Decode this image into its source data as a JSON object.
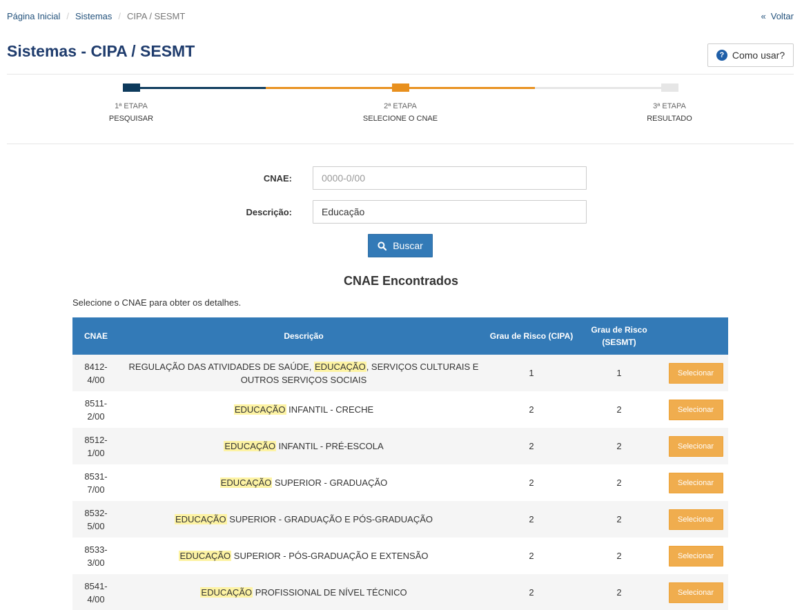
{
  "breadcrumb": {
    "home": "Página Inicial",
    "systems": "Sistemas",
    "current": "CIPA / SESMT",
    "separator": "/"
  },
  "back": {
    "chevron": "«",
    "label": "Voltar"
  },
  "page": {
    "title": "Sistemas - CIPA / SESMT"
  },
  "help": {
    "icon": "question-circle-icon",
    "glyph": "?",
    "label": "Como usar?"
  },
  "steps": [
    {
      "num": "1ª ETAPA",
      "label": "PESQUISAR",
      "status": "completed"
    },
    {
      "num": "2ª ETAPA",
      "label": "SELECIONE O CNAE",
      "status": "active"
    },
    {
      "num": "3ª ETAPA",
      "label": "RESULTADO",
      "status": "pending"
    }
  ],
  "colors": {
    "completed": "#0d3a5c",
    "active": "#e8901e",
    "pending": "#e6e6e6",
    "primary": "#337ab7",
    "warning": "#f0ad4e",
    "highlight": "#fdf3a3"
  },
  "form": {
    "cnae_label": "CNAE:",
    "cnae_placeholder": "0000-0/00",
    "cnae_value": "",
    "desc_label": "Descrição:",
    "desc_value": "Educação",
    "search_label": "Buscar",
    "search_icon": "search-icon"
  },
  "results": {
    "title": "CNAE Encontrados",
    "subtitle": "Selecione o CNAE para obter os detalhes.",
    "columns": [
      "CNAE",
      "Descrição",
      "Grau de Risco (CIPA)",
      "Grau de Risco (SESMT)",
      ""
    ],
    "highlight_term": "EDUCAÇÃO",
    "select_label": "Selecionar",
    "rows": [
      {
        "cnae_a": "8412-",
        "cnae_b": "4/00",
        "pre": "REGULAÇÃO DAS ATIVIDADES DE SAÚDE, ",
        "hl": "EDUCAÇÃO",
        "post": ", SERVIÇOS CULTURAIS E OUTROS SERVIÇOS SOCIAIS",
        "cipa": "1",
        "sesmt": "1"
      },
      {
        "cnae_a": "8511-",
        "cnae_b": "2/00",
        "pre": "",
        "hl": "EDUCAÇÃO",
        "post": " INFANTIL - CRECHE",
        "cipa": "2",
        "sesmt": "2"
      },
      {
        "cnae_a": "8512-",
        "cnae_b": "1/00",
        "pre": "",
        "hl": "EDUCAÇÃO",
        "post": " INFANTIL - PRÉ-ESCOLA",
        "cipa": "2",
        "sesmt": "2"
      },
      {
        "cnae_a": "8531-",
        "cnae_b": "7/00",
        "pre": "",
        "hl": "EDUCAÇÃO",
        "post": " SUPERIOR - GRADUAÇÃO",
        "cipa": "2",
        "sesmt": "2"
      },
      {
        "cnae_a": "8532-",
        "cnae_b": "5/00",
        "pre": "",
        "hl": "EDUCAÇÃO",
        "post": " SUPERIOR - GRADUAÇÃO E PÓS-GRADUAÇÃO",
        "cipa": "2",
        "sesmt": "2"
      },
      {
        "cnae_a": "8533-",
        "cnae_b": "3/00",
        "pre": "",
        "hl": "EDUCAÇÃO",
        "post": " SUPERIOR - PÓS-GRADUAÇÃO E EXTENSÃO",
        "cipa": "2",
        "sesmt": "2"
      },
      {
        "cnae_a": "8541-",
        "cnae_b": "4/00",
        "pre": "",
        "hl": "EDUCAÇÃO",
        "post": " PROFISSIONAL DE NÍVEL TÉCNICO",
        "cipa": "2",
        "sesmt": "2"
      }
    ]
  }
}
